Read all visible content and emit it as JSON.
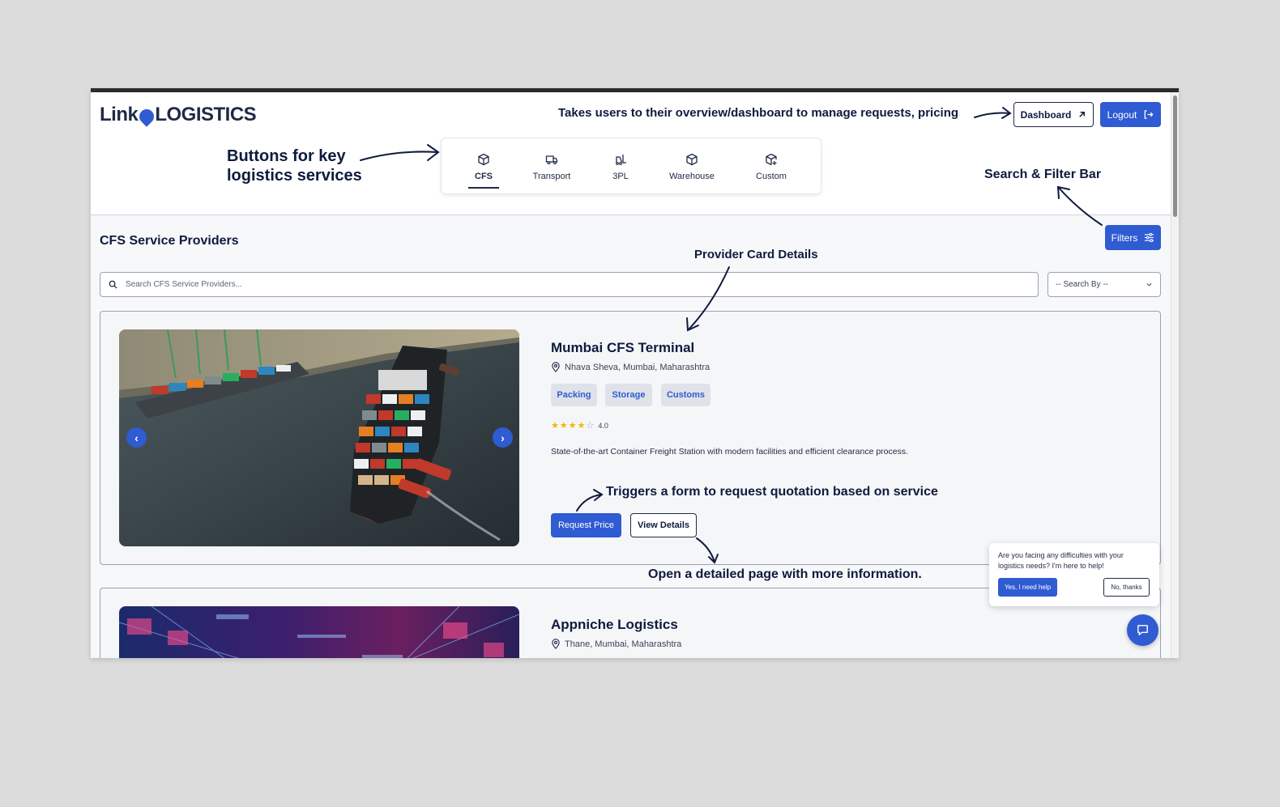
{
  "brand": {
    "link_text": "Link",
    "logistics_text": "LOGISTICS"
  },
  "header": {
    "dashboard_label": "Dashboard",
    "logout_label": "Logout"
  },
  "services": {
    "tabs": [
      {
        "label": "CFS",
        "icon": "box-icon",
        "active": true
      },
      {
        "label": "Transport",
        "icon": "truck-icon",
        "active": false
      },
      {
        "label": "3PL",
        "icon": "forklift-icon",
        "active": false
      },
      {
        "label": "Warehouse",
        "icon": "box-icon",
        "active": false
      },
      {
        "label": "Custom",
        "icon": "package-add-icon",
        "active": false
      }
    ]
  },
  "main": {
    "title": "CFS Service Providers",
    "filters_label": "Filters",
    "search_placeholder": "Search CFS Service Providers...",
    "search_by_label": "-- Search By --"
  },
  "providers": [
    {
      "name": "Mumbai CFS Terminal",
      "location": "Nhava Sheva, Mumbai, Maharashtra",
      "tags": [
        "Packing",
        "Storage",
        "Customs"
      ],
      "rating": 4.0,
      "rating_text": "4.0",
      "description": "State-of-the-art Container Freight Station with modern facilities and efficient clearance process.",
      "request_label": "Request Price",
      "details_label": "View Details"
    },
    {
      "name": "Appniche Logistics",
      "location": "Thane, Mumbai, Maharashtra"
    }
  ],
  "annotations": {
    "dashboard": "Takes users to their overview/dashboard to manage requests, pricing",
    "services_line1": "Buttons for key",
    "services_line2": "logistics services",
    "search_filter": "Search & Filter Bar",
    "card_details": "Provider Card Details",
    "request": "Triggers a form to request quotation based on service",
    "details": "Open a detailed page with more information."
  },
  "chat": {
    "message": "Are you facing any difficulties with your logistics needs? I'm here to help!",
    "yes_label": "Yes, I need help",
    "no_label": "No, thanks"
  },
  "colors": {
    "primary": "#2f5bd3",
    "navy": "#0f1b3d",
    "star": "#f5b400"
  }
}
